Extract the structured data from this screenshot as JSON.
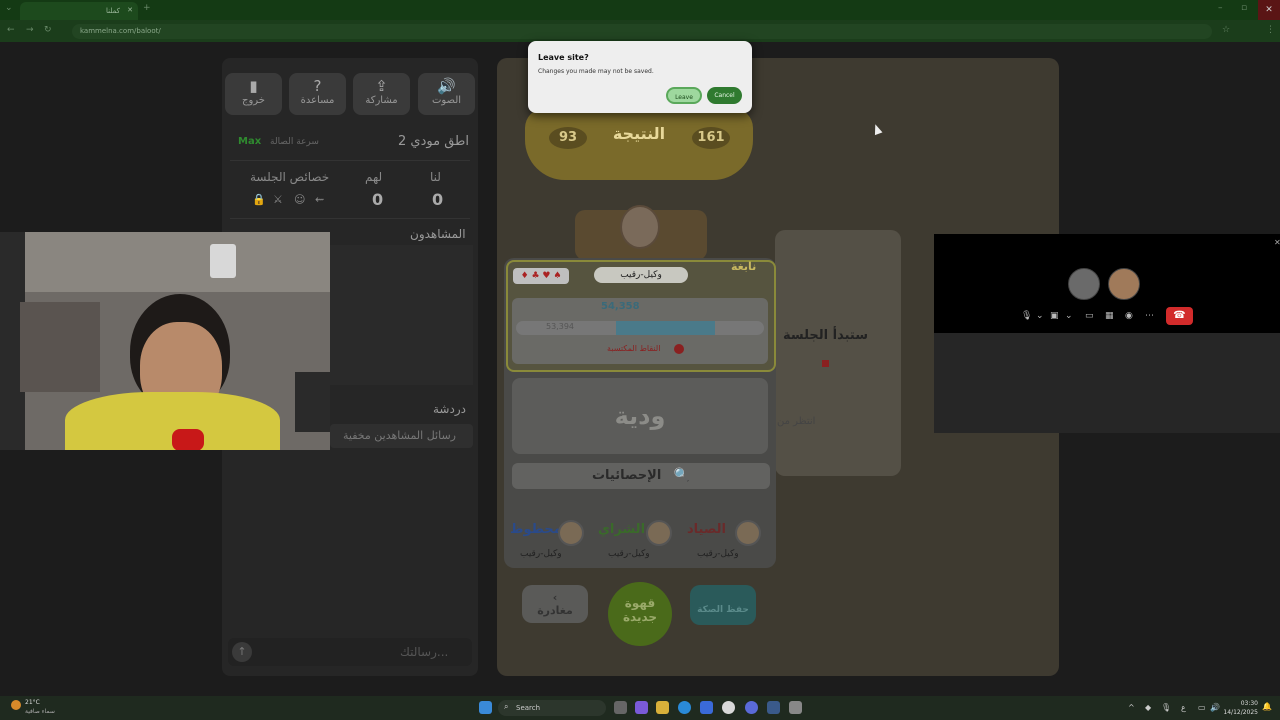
{
  "browser": {
    "tab_title": "كملنا",
    "url": "kammelna.com/baloot/"
  },
  "leave_dialog": {
    "title": "Leave site?",
    "message": "Changes you made may not be saved.",
    "leave_label": "Leave",
    "cancel_label": "Cancel"
  },
  "left_panel": {
    "buttons": {
      "sound": "الصوت",
      "share": "مشاركة",
      "help": "مساعدة",
      "exit": "خروج"
    },
    "room_name": "اطق مودي 2",
    "speed_label": "سرعة الصالة",
    "speed_value": "Max",
    "columns": {
      "us": "لنا",
      "them": "لهم",
      "session": "خصائص الجلسة"
    },
    "score_us": "0",
    "score_them": "0",
    "viewers_label": "المشاهدون",
    "chat_label": "دردشة",
    "viewers_hidden_msg": "رسائل المشاهدين مخفية",
    "message_placeholder": "رسالتك..."
  },
  "game": {
    "score_label": "النتيجة",
    "score_left": "93",
    "score_right": "161",
    "rank_label": "نابغة",
    "player_name": "وكيل-رقيب",
    "points_value": "54,358",
    "points_prev": "53,394",
    "points_progress_fraction": 0.4,
    "points_label": "النقاط المكتسبة",
    "mode": "ودية",
    "stats_label": "الإحصائيات",
    "achievements": [
      {
        "name": "المحظوظ",
        "player": "وكيل-رقيب"
      },
      {
        "name": "الشراي",
        "player": "وكيل-رقيب"
      },
      {
        "name": "الصياد",
        "player": "وكيل-رقيب"
      }
    ],
    "leave_button": "مغادرة",
    "new_coffee_button": "قهوة جديدة",
    "save_deck_button": "حفظ الصكة",
    "side_text_1": "ستبدأ الجلسة",
    "side_text_2": "انتظر من"
  },
  "taskbar": {
    "weather_temp": "21°C",
    "weather_desc": "سماء صافية",
    "search_label": "Search",
    "lang": "ع",
    "time": "03:30",
    "date": "14/12/2025"
  },
  "colors": {
    "accent_green": "#2f8a2f",
    "hangup_red": "#d22b2b",
    "gold": "#7a6a2a"
  }
}
